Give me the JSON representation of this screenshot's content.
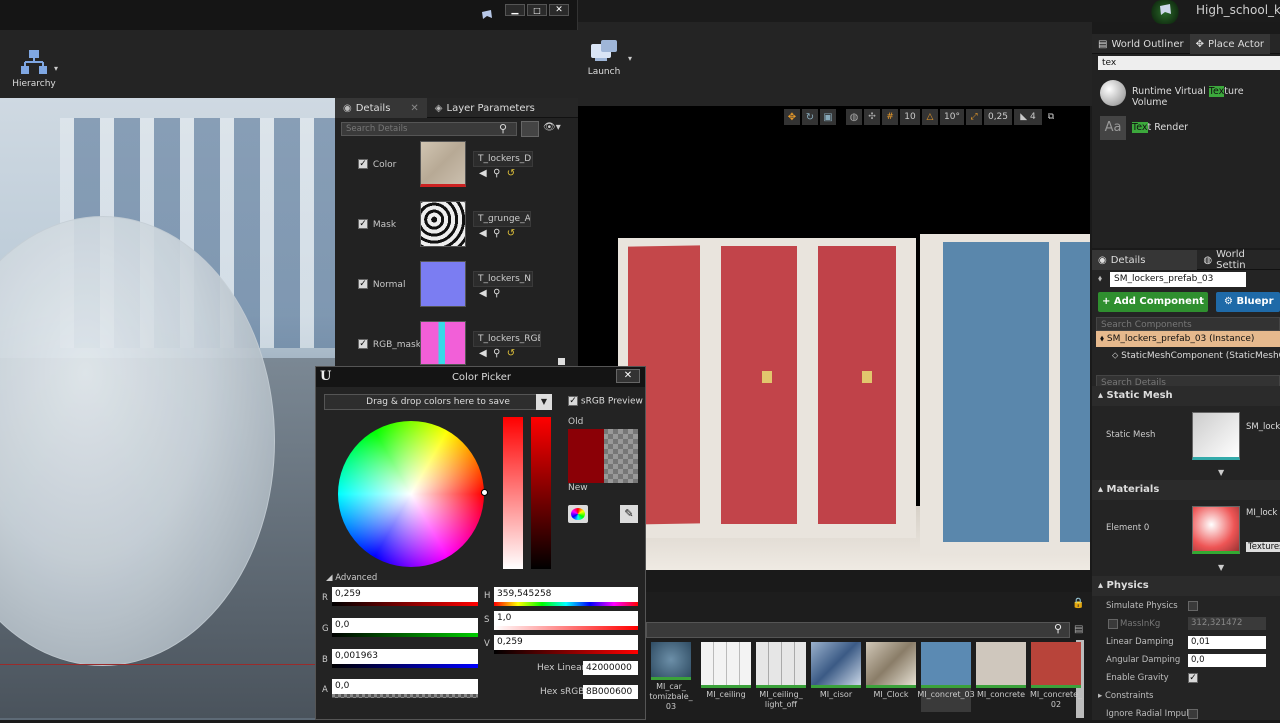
{
  "window": {
    "project_title": "High_school_kit",
    "launch_label": "Launch",
    "hierarchy_label": "Hierarchy"
  },
  "material_editor": {
    "tabs": [
      {
        "label": "Details"
      },
      {
        "label": "Layer Parameters"
      }
    ],
    "search_placeholder": "Search Details",
    "params": [
      {
        "name": "Color",
        "texture": "T_lockers_D"
      },
      {
        "name": "Mask",
        "texture": "T_grunge_A"
      },
      {
        "name": "Normal",
        "texture": "T_lockers_N"
      },
      {
        "name": "RGB_mask",
        "texture": "T_lockers_RGE"
      }
    ]
  },
  "color_picker": {
    "title": "Color Picker",
    "drag_drop": "Drag & drop colors here to save",
    "srgb_preview": "sRGB Preview",
    "old_label": "Old",
    "new_label": "New",
    "advanced_label": "Advanced",
    "channels": [
      {
        "label": "R",
        "value": "0,259"
      },
      {
        "label": "G",
        "value": "0,0"
      },
      {
        "label": "B",
        "value": "0,001963"
      },
      {
        "label": "A",
        "value": "0,0"
      }
    ],
    "hsv": [
      {
        "label": "H",
        "value": "359,545258"
      },
      {
        "label": "S",
        "value": "1,0"
      },
      {
        "label": "V",
        "value": "0,259"
      }
    ],
    "hex_linear_label": "Hex Linear",
    "hex_linear": "42000000",
    "hex_srgb_label": "Hex sRGB",
    "hex_srgb": "8B000600",
    "colors": {
      "old": "#8b0006",
      "new": "#8b0006"
    }
  },
  "viewport": {
    "grid_snap": "10",
    "rot_snap": "10°",
    "scale_snap": "0,25",
    "cam_speed": "4"
  },
  "content_browser": {
    "assets": [
      {
        "label": "MI_car_ tomizbale_ 03"
      },
      {
        "label": "MI_ceiling"
      },
      {
        "label": "MI_ceiling_ light_off"
      },
      {
        "label": "MI_cisor"
      },
      {
        "label": "MI_Clock"
      },
      {
        "label": "MI_concret_03"
      },
      {
        "label": "MI_concrete"
      },
      {
        "label": "MI_concrete_ 02"
      }
    ]
  },
  "outliner": {
    "tabs": [
      {
        "label": "World Outliner"
      },
      {
        "label": "Place Actor"
      }
    ],
    "search_value": "tex",
    "results": [
      {
        "pre": "Runtime Virtual ",
        "hl": "Tex",
        "post": "ture Volume"
      },
      {
        "pre": "",
        "hl": "Tex",
        "post": "t Render"
      }
    ]
  },
  "details": {
    "tabs": [
      {
        "label": "Details"
      },
      {
        "label": "World Settin"
      }
    ],
    "actor_name": "SM_lockers_prefab_03",
    "add_component": "+ Add Component ▾",
    "blueprint": "Bluepr",
    "search_components": "Search Components",
    "instance_label": "SM_lockers_prefab_03 (Instance)",
    "component_label": "StaticMeshComponent (StaticMeshCo",
    "search_details": "Search Details",
    "static_mesh_section": "Static Mesh",
    "static_mesh_label": "Static Mesh",
    "static_mesh_value": "SM_lock",
    "materials_section": "Materials",
    "element_label": "Element 0",
    "element_value": "MI_lock",
    "element_sub": "Textures",
    "physics_section": "Physics",
    "simulate_physics": "Simulate Physics",
    "mass_label": "MassInKg",
    "mass_value": "312,321472",
    "linear_damping": "Linear Damping",
    "linear_value": "0,01",
    "angular_damping": "Angular Damping",
    "angular_value": "0,0",
    "enable_gravity": "Enable Gravity",
    "constraints": "Constraints",
    "ignore_radial": "Ignore Radial Impuls"
  }
}
